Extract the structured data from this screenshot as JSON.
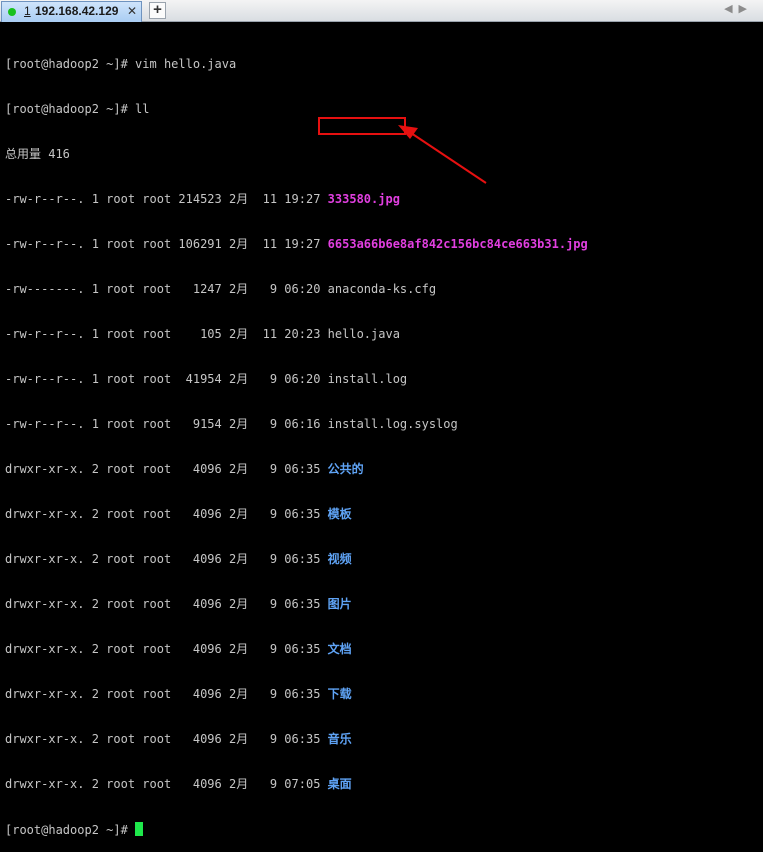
{
  "tab": {
    "index": "1",
    "host": "192.168.42.129",
    "close": "✕"
  },
  "tabbar": {
    "add": "+",
    "scroll_left": "◀",
    "scroll_right": "▶"
  },
  "terminal": {
    "cmd1": "[root@hadoop2 ~]# vim hello.java",
    "cmd2": "[root@hadoop2 ~]# ll",
    "total": "总用量 416",
    "rows": [
      {
        "meta": "-rw-r--r--. 1 root root 214523 2月  11 19:27 ",
        "name": "333580.jpg"
      },
      {
        "meta": "-rw-r--r--. 1 root root 106291 2月  11 19:27 ",
        "name": "6653a66b6e8af842c156bc84ce663b31.jpg"
      },
      {
        "meta": "-rw-------. 1 root root   1247 2月   9 06:20 ",
        "name": "anaconda-ks.cfg"
      },
      {
        "meta": "-rw-r--r--. 1 root root    105 2月  11 20:23 ",
        "name": "hello.java"
      },
      {
        "meta": "-rw-r--r--. 1 root root  41954 2月   9 06:20 ",
        "name": "install.log"
      },
      {
        "meta": "-rw-r--r--. 1 root root   9154 2月   9 06:16 ",
        "name": "install.log.syslog"
      },
      {
        "meta": "drwxr-xr-x. 2 root root   4096 2月   9 06:35 ",
        "name": "公共的"
      },
      {
        "meta": "drwxr-xr-x. 2 root root   4096 2月   9 06:35 ",
        "name": "模板"
      },
      {
        "meta": "drwxr-xr-x. 2 root root   4096 2月   9 06:35 ",
        "name": "视频"
      },
      {
        "meta": "drwxr-xr-x. 2 root root   4096 2月   9 06:35 ",
        "name": "图片"
      },
      {
        "meta": "drwxr-xr-x. 2 root root   4096 2月   9 06:35 ",
        "name": "文档"
      },
      {
        "meta": "drwxr-xr-x. 2 root root   4096 2月   9 06:35 ",
        "name": "下载"
      },
      {
        "meta": "drwxr-xr-x. 2 root root   4096 2月   9 06:35 ",
        "name": "音乐"
      },
      {
        "meta": "drwxr-xr-x. 2 root root   4096 2月   9 07:05 ",
        "name": "桌面"
      }
    ],
    "prompt": "[root@hadoop2 ~]# "
  },
  "colors": {
    "image_file": "#e13fe0",
    "directory": "#5fa3f5",
    "text": "#c6c6c6",
    "cursor": "#1ee84b",
    "annotation": "#e61010"
  }
}
